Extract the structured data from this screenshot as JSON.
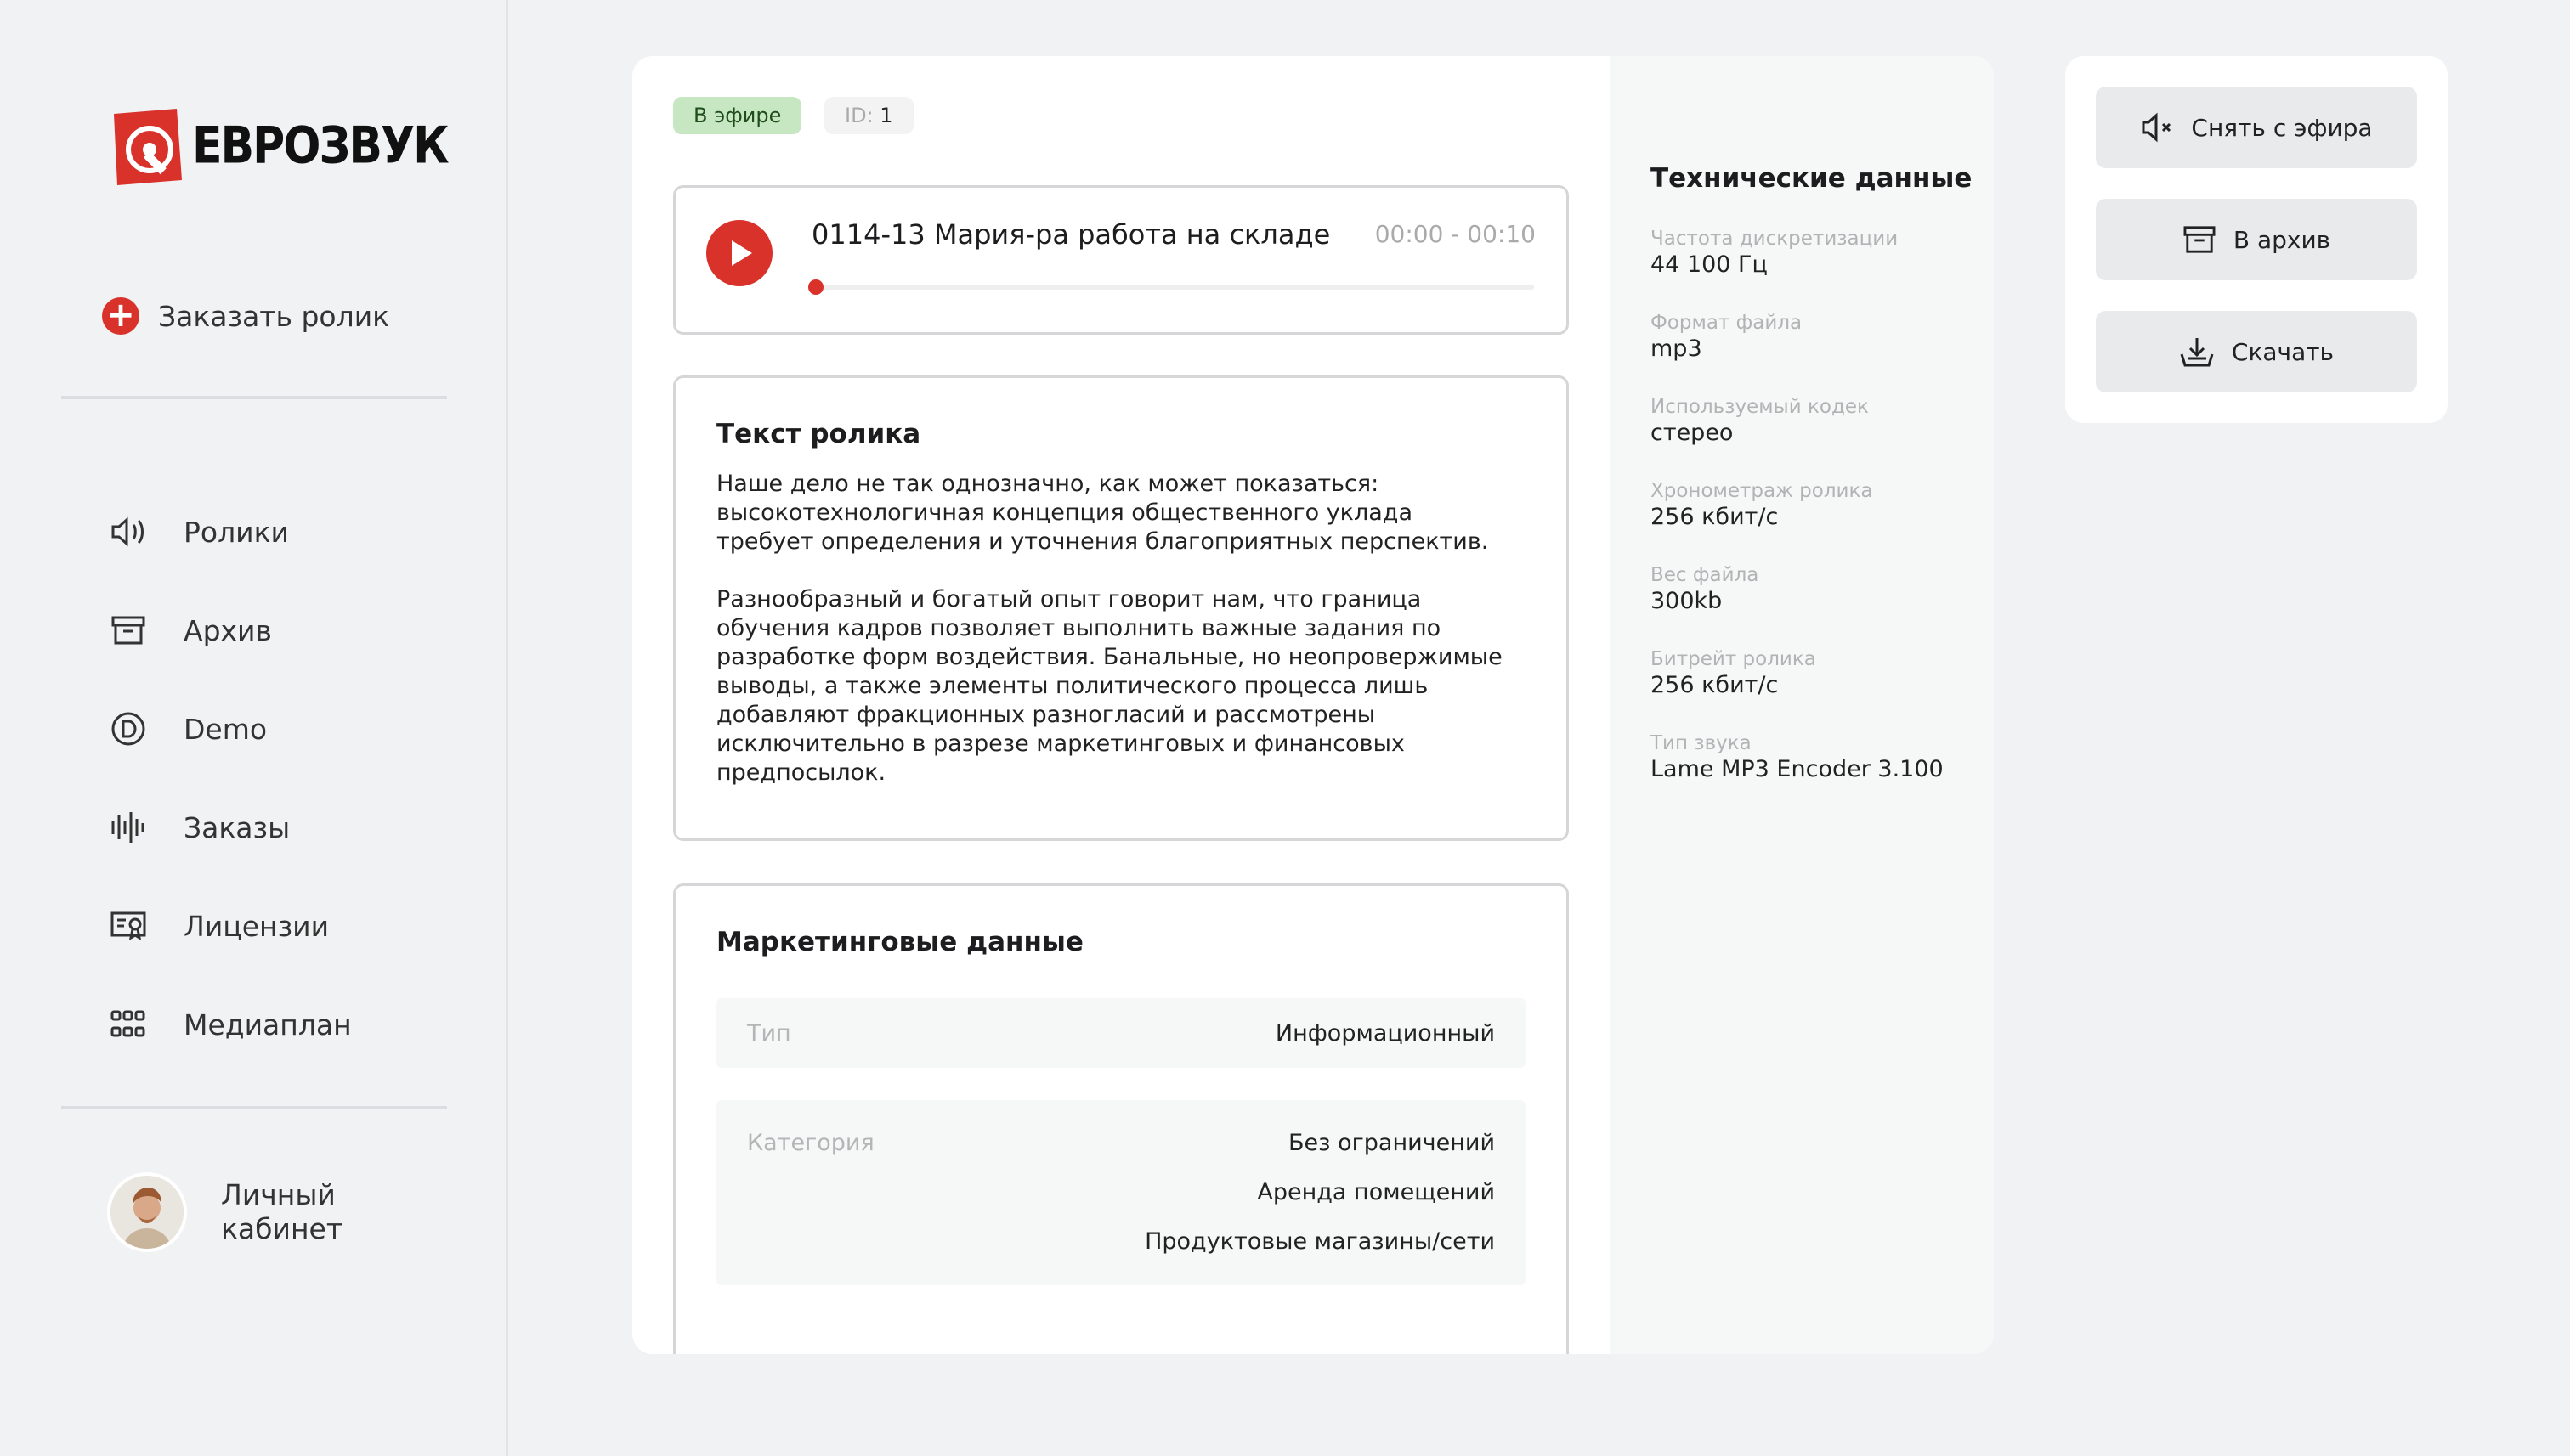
{
  "brand": {
    "name": "ЕВРОЗВУК",
    "accent": "#d9322b"
  },
  "sidebar": {
    "order_label": "Заказать ролик",
    "items": [
      {
        "label": "Ролики",
        "icon": "speaker-icon"
      },
      {
        "label": "Архив",
        "icon": "archive-icon"
      },
      {
        "label": "Demo",
        "icon": "demo-icon"
      },
      {
        "label": "Заказы",
        "icon": "waveform-icon"
      },
      {
        "label": "Лицензии",
        "icon": "certificate-icon"
      },
      {
        "label": "Медиаплан",
        "icon": "grid-icon"
      }
    ],
    "profile_label": "Личный кабинет"
  },
  "clip": {
    "status": "В эфире",
    "id_label": "ID:",
    "id_value": "1",
    "title": "0114-13 Мария-ра работа на складе",
    "time": "00:00 - 00:10",
    "progress": 0
  },
  "text_section": {
    "title": "Текст ролика",
    "paragraphs": [
      "Наше дело не так однозначно, как может показаться:\nвысокотехнологичная концепция общественного уклада\nтребует определения и уточнения благоприятных перспектив.",
      "Разнообразный и богатый опыт говорит нам, что граница\nобучения кадров позволяет выполнить важные задания по\nразработке форм воздействия. Банальные, но неопровержимые\nвыводы, а также элементы политического процесса лишь\nдобавляют фракционных разногласий и рассмотрены\nисключительно в разрезе маркетинговых и финансовых\nпредпосылок."
    ]
  },
  "marketing": {
    "title": "Маркетинговые данные",
    "type_label": "Тип",
    "type_value": "Информационный",
    "category_label": "Категория",
    "categories": [
      "Без ограничений",
      "Аренда помещений",
      "Продуктовые магазины/сети"
    ]
  },
  "tech": {
    "title": "Технические данные",
    "items": [
      {
        "label": "Частота дискретизации",
        "value": "44 100 Гц"
      },
      {
        "label": "Формат файла",
        "value": "mp3"
      },
      {
        "label": "Используемый кодек",
        "value": "стерео"
      },
      {
        "label": "Хронометраж ролика",
        "value": "256 кбит/с"
      },
      {
        "label": "Вес файла",
        "value": "300kb"
      },
      {
        "label": "Битрейт ролика",
        "value": "256 кбит/с"
      },
      {
        "label": "Тип звука",
        "value": "Lame MP3 Encoder 3.100"
      }
    ]
  },
  "actions": {
    "unpublish": "Снять с эфира",
    "archive": "В архив",
    "download": "Скачать"
  }
}
